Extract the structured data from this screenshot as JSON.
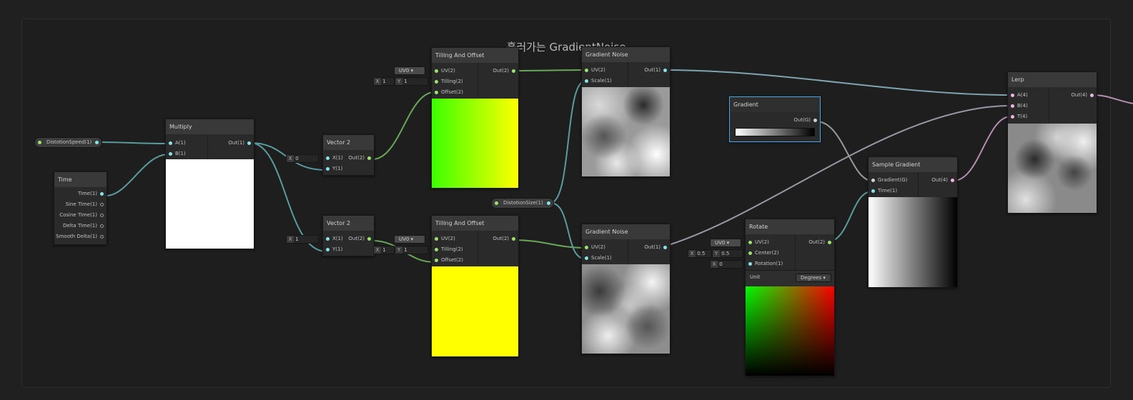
{
  "group": {
    "title": "흘러가는 GradientNoise"
  },
  "properties": {
    "distortion_speed": "DistotionSpeed(1)",
    "distortion_size": "DistotionSize(1)"
  },
  "time": {
    "title": "Time",
    "outputs": [
      "Time(1)",
      "Sine Time(1)",
      "Cosine Time(1)",
      "Delta Time(1)",
      "Smooth Delta(1)"
    ]
  },
  "multiply": {
    "title": "Multiply",
    "in_a": "A(1)",
    "in_b": "B(1)",
    "out": "Out(1)"
  },
  "vector2_top": {
    "title": "Vector 2",
    "in_x": "X(1)",
    "in_y": "Y(1)",
    "out": "Out(2)",
    "x_label": "X",
    "x_value": "0"
  },
  "vector2_bottom": {
    "title": "Vector 2",
    "in_x": "X(1)",
    "in_y": "Y(1)",
    "out": "Out(2)",
    "x_label": "X",
    "x_value": "1"
  },
  "tiling_top": {
    "title": "Tilling And Offset",
    "uv": "UV(2)",
    "tiling": "Tilling(2)",
    "offset": "Offset(2)",
    "out": "Out(2)",
    "uv_channel": "UV0",
    "tiling_x_label": "X",
    "tiling_x": "1",
    "tiling_y_label": "Y",
    "tiling_y": "1"
  },
  "tiling_bottom": {
    "title": "Tilling And Offset",
    "uv": "UV(2)",
    "tiling": "Tilling(2)",
    "offset": "Offset(2)",
    "out": "Out(2)",
    "uv_channel": "UV0",
    "tiling_x_label": "X",
    "tiling_x": "1",
    "tiling_y_label": "Y",
    "tiling_y": "1"
  },
  "noise_top": {
    "title": "Gradient Noise",
    "uv": "UV(2)",
    "scale": "Scale(1)",
    "out": "Out(1)"
  },
  "noise_bottom": {
    "title": "Gradient Noise",
    "uv": "UV(2)",
    "scale": "Scale(1)",
    "out": "Out(1)"
  },
  "gradient": {
    "title": "Gradient",
    "out": "Out(G)"
  },
  "rotate": {
    "title": "Rotate",
    "uv": "UV(2)",
    "center": "Center(2)",
    "rotation": "Rotation(1)",
    "out": "Out(2)",
    "uv_channel": "UV0",
    "center_x_label": "X",
    "center_x": "0.5",
    "center_y_label": "Y",
    "center_y": "0.5",
    "rotation_label": "X",
    "rotation_value": "0",
    "unit_label": "Unit",
    "unit_value": "Degrees"
  },
  "sample_gradient": {
    "title": "Sample Gradient",
    "gradient_in": "Gradient(G)",
    "time_in": "Time(1)",
    "out": "Out(4)"
  },
  "lerp": {
    "title": "Lerp",
    "in_a": "A(4)",
    "in_b": "B(4)",
    "in_t": "T(4)",
    "out": "Out(4)"
  },
  "colors": {
    "float_port": "#84e4e7",
    "vector2_port": "#9ae36f",
    "vector4_port": "#f1b4e2",
    "selection": "#44a9e6"
  }
}
